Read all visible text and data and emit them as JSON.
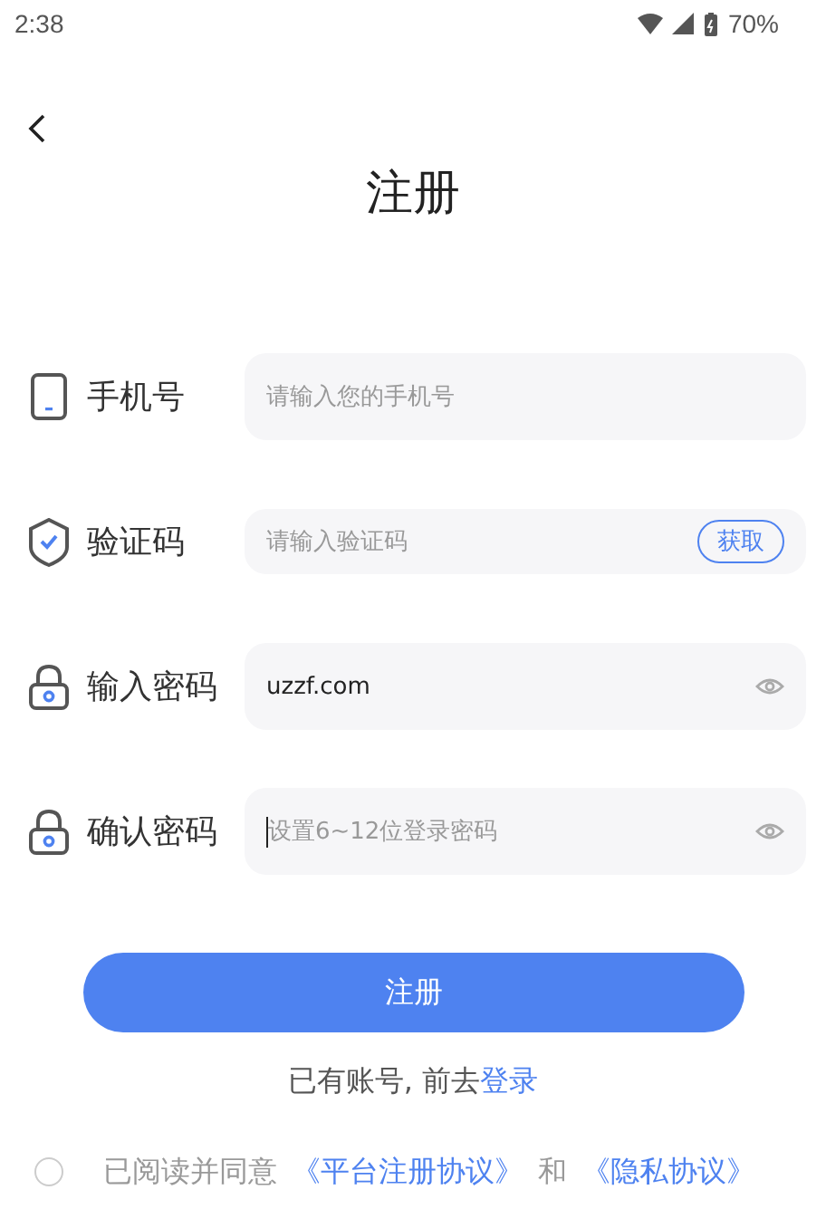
{
  "status_bar": {
    "time": "2:38",
    "battery": "70%"
  },
  "title": "注册",
  "fields": [
    {
      "kind": "phone",
      "label": "手机号",
      "placeholder": "请输入您的手机号",
      "focused": false
    },
    {
      "kind": "code",
      "label": "验证码",
      "placeholder": "请输入验证码",
      "action": "获取",
      "focused": false
    },
    {
      "kind": "password",
      "label": "输入密码",
      "value": "uzzf.com",
      "focused": false
    },
    {
      "kind": "password",
      "label": "确认密码",
      "placeholder": "设置6~12位登录密码",
      "focused": true
    }
  ],
  "submit": "注册",
  "login_prompt": {
    "text": "已有账号, 前去",
    "link": "登录"
  },
  "agreement": {
    "checked": false,
    "text": "已阅读并同意",
    "link_1": "《平台注册协议》",
    "joiner": "和",
    "link_2": "《隐私协议》"
  }
}
